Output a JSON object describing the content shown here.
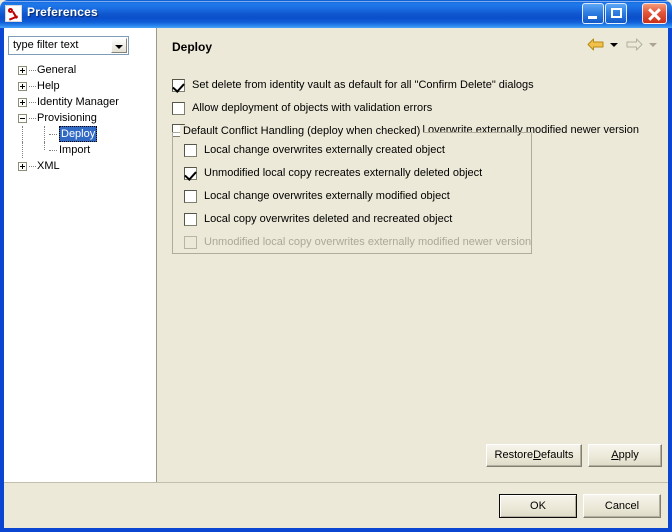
{
  "window": {
    "title": "Preferences",
    "icon": "preferences-app-icon",
    "controls": {
      "minimize": "minimize-button",
      "maximize": "maximize-button",
      "close": "close-button"
    }
  },
  "colors": {
    "titlebar_blue": "#0b5fd6",
    "frame_blue": "#0a46d2",
    "panel_beige": "#ece9d8",
    "tree_background": "#ffffff",
    "selection_blue": "#316ac5",
    "disabled_text": "#aca899",
    "back_arrow_gold": "#e8a81c"
  },
  "sidebar": {
    "filter": {
      "value": "type filter text",
      "dropdown_icon": "chevron-down-icon"
    },
    "tree": [
      {
        "label": "General",
        "level": 0,
        "state": "collapsed",
        "selected": false
      },
      {
        "label": "Help",
        "level": 0,
        "state": "collapsed",
        "selected": false
      },
      {
        "label": "Identity Manager",
        "level": 0,
        "state": "collapsed",
        "selected": false
      },
      {
        "label": "Provisioning",
        "level": 0,
        "state": "expanded",
        "selected": false
      },
      {
        "label": "Deploy",
        "level": 1,
        "state": "leaf",
        "selected": true
      },
      {
        "label": "Import",
        "level": 1,
        "state": "leaf",
        "selected": false
      },
      {
        "label": "XML",
        "level": 0,
        "state": "collapsed",
        "selected": false
      }
    ]
  },
  "main": {
    "title": "Deploy",
    "nav": {
      "back_icon": "arrow-left-icon",
      "back_menu_icon": "chevron-down-icon",
      "back_enabled": true,
      "forward_icon": "arrow-right-icon",
      "forward_menu_icon": "chevron-down-icon",
      "forward_enabled": false
    },
    "options": [
      {
        "label": "Set delete from identity vault as default for all \"Confirm Delete\" dialogs",
        "checked": true,
        "enabled": true
      },
      {
        "label": "Allow deployment of objects with validation errors",
        "checked": false,
        "enabled": true
      },
      {
        "label": "Allow deployment of unmodified objects that will overwrite externally modified newer version",
        "checked": false,
        "enabled": true
      }
    ],
    "group": {
      "legend": "Default Conflict Handling (deploy when checked)",
      "options": [
        {
          "label": "Local change overwrites externally created object",
          "checked": false,
          "enabled": true
        },
        {
          "label": "Unmodified local copy recreates externally deleted object",
          "checked": true,
          "enabled": true
        },
        {
          "label": "Local change overwrites externally modified object",
          "checked": false,
          "enabled": true
        },
        {
          "label": "Local copy overwrites deleted and recreated object",
          "checked": false,
          "enabled": true
        },
        {
          "label": "Unmodified local copy overwrites externally modified newer version",
          "checked": false,
          "enabled": false
        }
      ]
    },
    "buttons": {
      "restore_defaults": {
        "prefix": "Restore ",
        "mnemonic": "D",
        "suffix": "efaults"
      },
      "apply": {
        "prefix": "",
        "mnemonic": "A",
        "suffix": "pply"
      }
    }
  },
  "footer": {
    "ok": "OK",
    "cancel": "Cancel",
    "default_button": "ok"
  }
}
